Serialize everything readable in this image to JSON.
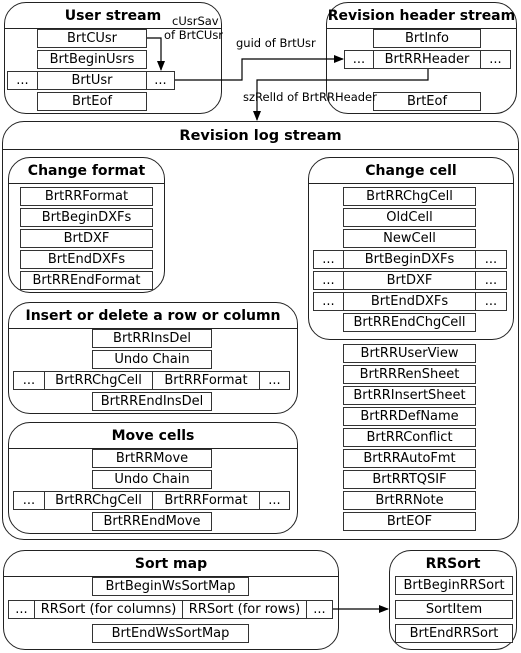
{
  "user_stream": {
    "title": "User stream",
    "records": {
      "cusr": "BrtCUsr",
      "begin": "BrtBeginUsrs",
      "usr_pre": "...",
      "usr": "BrtUsr",
      "usr_post": "...",
      "eof": "BrtEof"
    }
  },
  "revision_header_stream": {
    "title": "Revision header stream",
    "records": {
      "info": "BrtInfo",
      "hdr_pre": "...",
      "header": "BrtRRHeader",
      "hdr_post": "...",
      "eof": "BrtEof"
    }
  },
  "connectors": {
    "cusrsav": [
      "cUsrSav",
      "of BrtCUsr"
    ],
    "guid": "guid of BrtUsr",
    "szrelid": "szRelId of BrtRRHeader",
    "rrsort": ""
  },
  "revision_log_stream": {
    "title": "Revision log stream",
    "change_format": {
      "title": "Change format",
      "records": [
        "BrtRRFormat",
        "BrtBeginDXFs",
        "BrtDXF",
        "BrtEndDXFs",
        "BrtRREndFormat"
      ]
    },
    "insert_delete": {
      "title": "Insert or delete a row or column",
      "records": {
        "first": "BrtRRInsDel",
        "undo": "Undo Chain",
        "pre": "...",
        "chg": "BrtRRChgCell",
        "fmt": "BrtRRFormat",
        "post": "...",
        "end": "BrtRREndInsDel"
      }
    },
    "move_cells": {
      "title": "Move cells",
      "records": {
        "first": "BrtRRMove",
        "undo": "Undo Chain",
        "pre": "...",
        "chg": "BrtRRChgCell",
        "fmt": "BrtRRFormat",
        "post": "...",
        "end": "BrtRREndMove"
      }
    },
    "change_cell": {
      "title": "Change cell",
      "records": {
        "chg": "BrtRRChgCell",
        "old": "OldCell",
        "new": "NewCell",
        "begin_pre": "...",
        "begin": "BrtBeginDXFs",
        "begin_post": "...",
        "dxf_pre": "...",
        "dxf": "BrtDXF",
        "dxf_post": "...",
        "end_pre": "...",
        "end": "BrtEndDXFs",
        "end_post": "...",
        "endchg": "BrtRREndChgCell"
      }
    },
    "other_records": [
      "BrtRRUserView",
      "BrtRRRenSheet",
      "BrtRRInsertSheet",
      "BrtRRDefName",
      "BrtRRConflict",
      "BrtRRAutoFmt",
      "BrtRRTQSIF",
      "BrtRRNote",
      "BrtEOF"
    ]
  },
  "sort_map": {
    "title": "Sort map",
    "records": {
      "begin": "BrtBeginWsSortMap",
      "pre": "...",
      "cols": "RRSort (for columns)",
      "rows": "RRSort (for rows)",
      "post": "...",
      "end": "BrtEndWsSortMap"
    }
  },
  "rrsort": {
    "title": "RRSort",
    "records": [
      "BrtBeginRRSort",
      "SortItem",
      "BrtEndRRSort"
    ]
  }
}
